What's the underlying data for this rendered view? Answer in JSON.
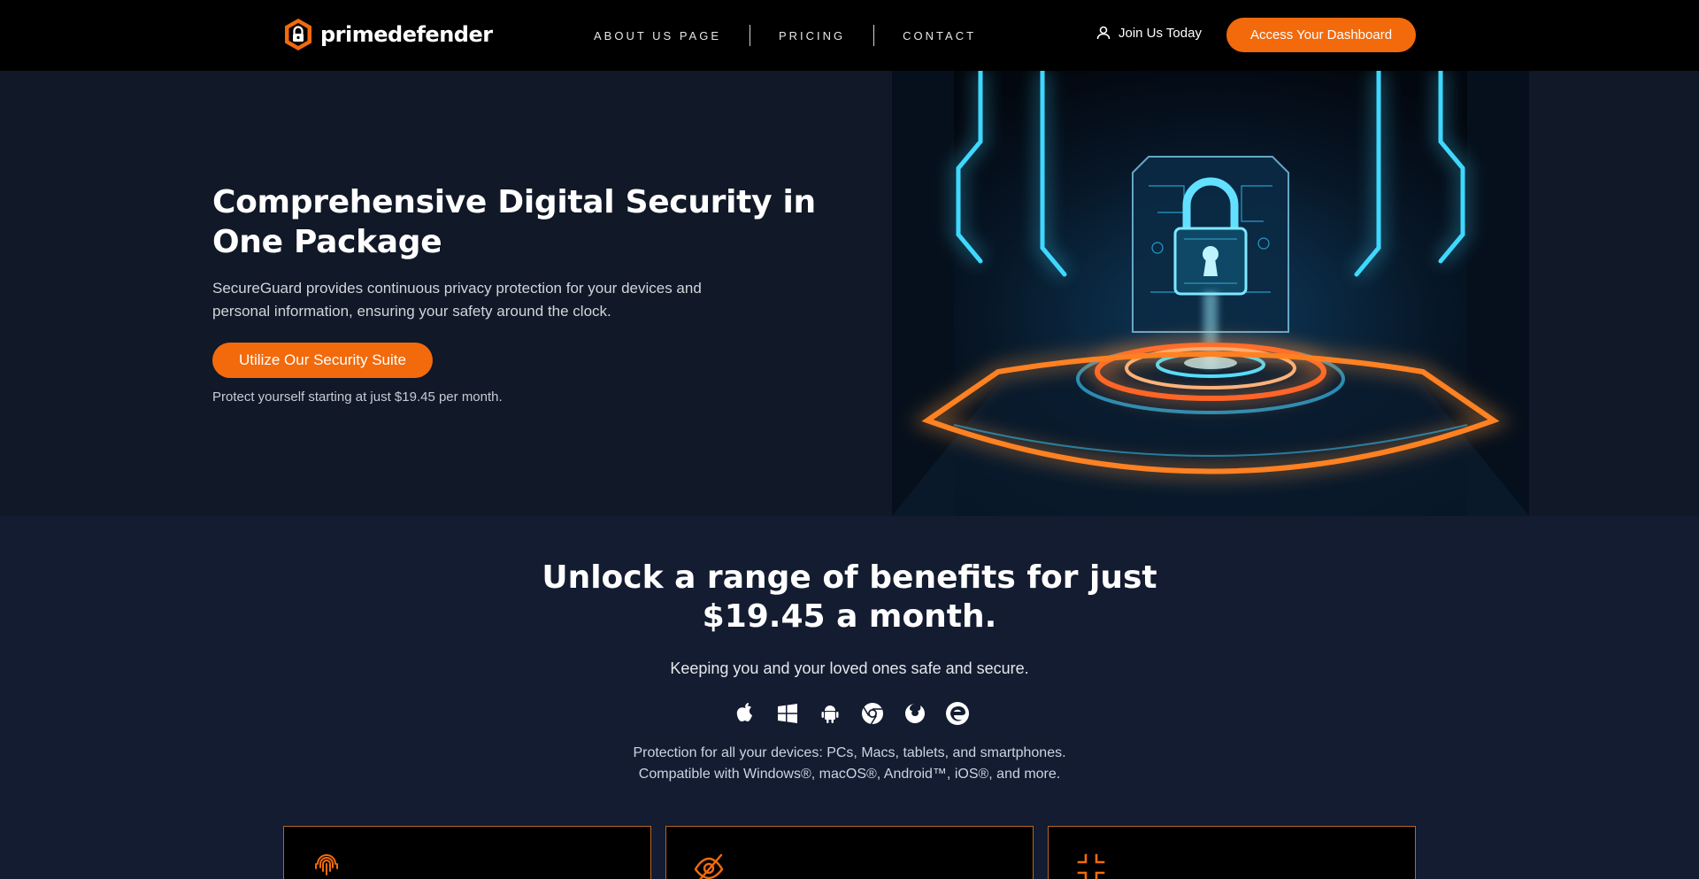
{
  "brand": {
    "name": "primedefender",
    "accent": "#f26a0c"
  },
  "nav": {
    "links": [
      "ABOUT US PAGE",
      "PRICING",
      "CONTACT"
    ],
    "join_label": "Join Us Today",
    "dashboard_label": "Access Your Dashboard"
  },
  "hero": {
    "title": "Comprehensive Digital Security in One Package",
    "description": "SecureGuard provides continuous privacy protection for your devices and personal information, ensuring your safety around the clock.",
    "cta_label": "Utilize Our Security Suite",
    "note": "Protect yourself starting at just $19.45 per month.",
    "image_icon": "neon-padlock-illustration"
  },
  "benefits": {
    "title": "Unlock a range of benefits for just $19.45 a month.",
    "subtitle": "Keeping you and your loved ones safe and secure.",
    "platform_icons": [
      "apple-icon",
      "windows-icon",
      "android-icon",
      "chrome-icon",
      "firefox-icon",
      "edge-icon"
    ],
    "compat_line1": "Protection for all your devices: PCs, Macs, tablets, and smartphones.",
    "compat_line2": "Compatible with Windows®, macOS®, Android™, iOS®, and more.",
    "card_icons": [
      "fingerprint-icon",
      "eye-off-icon",
      "shrink-icon"
    ]
  }
}
